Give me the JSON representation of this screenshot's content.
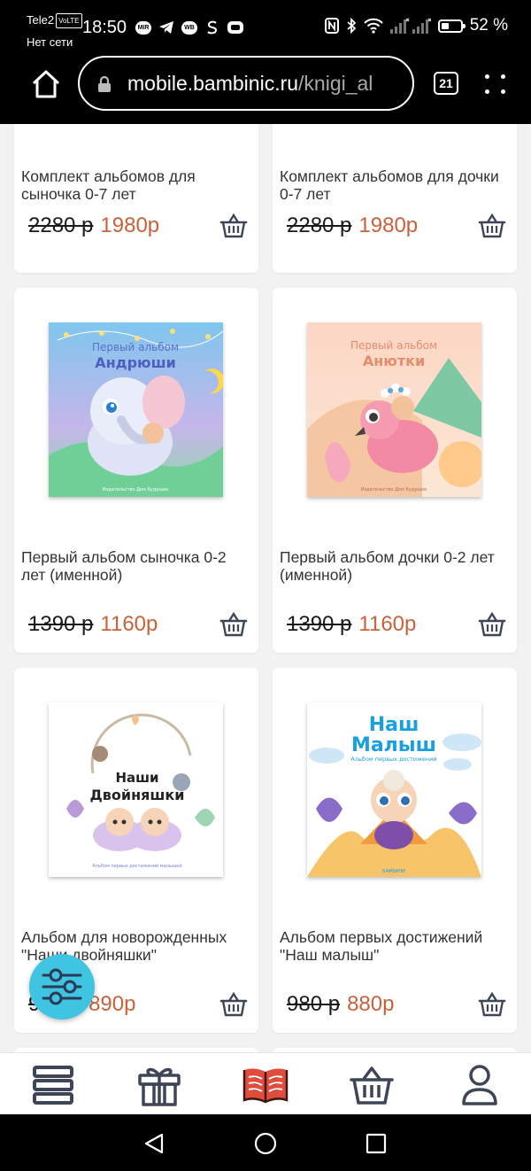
{
  "status_bar": {
    "carrier": "Tele2",
    "network_badge": "VoLTE",
    "network_status": "Нет сети",
    "time": "18:50",
    "app_badge": "MIR",
    "app_badge_2": "WB",
    "battery_level": 0.52,
    "battery": "52 %"
  },
  "browser": {
    "url_domain": "mobile.bambinic.ru",
    "url_path": "/knigi_al",
    "tab_count": "21"
  },
  "products": [
    {
      "title": "Комплект альбомов для сыночка 0-7 лет",
      "old_price": "2280 р",
      "new_price": "1980р"
    },
    {
      "title": "Комплект альбомов для дочки 0-7 лет",
      "old_price": "2280 р",
      "new_price": "1980р"
    },
    {
      "title": "Первый альбом сыночка 0-2 лет (именной)",
      "old_price": "1390 р",
      "new_price": "1160р",
      "cover_title_1": "Первый альбом",
      "cover_title_2": "Андрюши",
      "cover_footer": "Издательство Дом Будущее"
    },
    {
      "title": "Первый альбом дочки 0-2 лет (именной)",
      "old_price": "1390 р",
      "new_price": "1160р",
      "cover_title_1": "Первый альбом",
      "cover_title_2": "Анютки",
      "cover_footer": "Издательство Дом Будущее"
    },
    {
      "title": "Альбом для новорожденных \"Наши двойняшки\"",
      "old_price": "990 р",
      "new_price": "890р",
      "cover_title_1": "Наши",
      "cover_title_2": "Двойняшки",
      "cover_footer": "Альбом первых достижений малышей"
    },
    {
      "title": "Альбом первых достижений \"Наш малыш\"",
      "old_price": "980 р",
      "new_price": "880р",
      "cover_title_1": "Наш",
      "cover_title_2": "Малыш",
      "cover_subtitle": "Альбом первых достижений",
      "cover_footer": "БАМБИНИ"
    }
  ],
  "colors": {
    "new_price": "#c9623a",
    "filter_button": "#3fc4e2",
    "nav_active": "#e24c3b",
    "nav_icon": "#3e4556"
  },
  "icons": {
    "filter": "sliders-icon",
    "cart": "basket-icon",
    "nav": [
      "menu-icon",
      "gift-icon",
      "book-icon",
      "basket-icon",
      "user-icon"
    ]
  }
}
